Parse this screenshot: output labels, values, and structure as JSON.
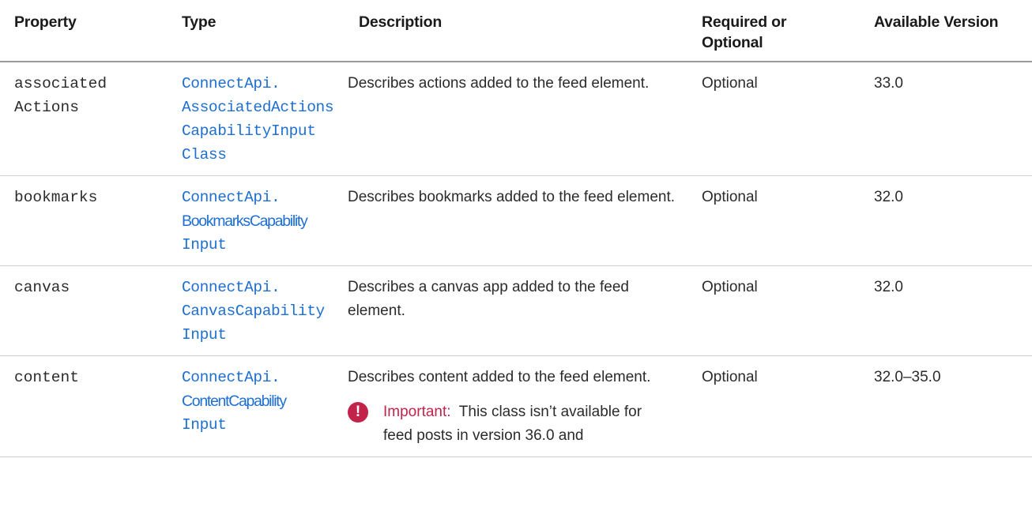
{
  "headers": [
    "Property",
    "Type",
    "Description",
    "Required or Optional",
    "Available Version"
  ],
  "rows": [
    {
      "property": [
        "associated",
        "Actions"
      ],
      "type": [
        "ConnectApi.",
        "AssociatedActions",
        "CapabilityInput",
        "Class"
      ],
      "description": "Describes actions added to the feed element.",
      "required": "Optional",
      "version": "33.0"
    },
    {
      "property": [
        "bookmarks"
      ],
      "type": [
        "ConnectApi.",
        "BookmarksCapability",
        "Input"
      ],
      "description": "Describes bookmarks added to the feed element.",
      "required": "Optional",
      "version": "32.0"
    },
    {
      "property": [
        "canvas"
      ],
      "type": [
        "ConnectApi.",
        "CanvasCapability",
        "Input"
      ],
      "description": "Describes a canvas app added to the feed element.",
      "required": "Optional",
      "version": "32.0"
    },
    {
      "property": [
        "content"
      ],
      "type": [
        "ConnectApi.",
        "ContentCapability",
        "Input"
      ],
      "description": "Describes content added to the feed element.",
      "required": "Optional",
      "version": "32.0–35.0",
      "note": {
        "icon": "important-icon",
        "label": "Important:",
        "text": "This class isn’t available for feed posts in version 36.0 and"
      }
    }
  ],
  "colors": {
    "link": "#1e6fd1",
    "important": "#c2234b",
    "header_rule": "#9a9a9a",
    "row_rule": "#cfcfcf"
  }
}
